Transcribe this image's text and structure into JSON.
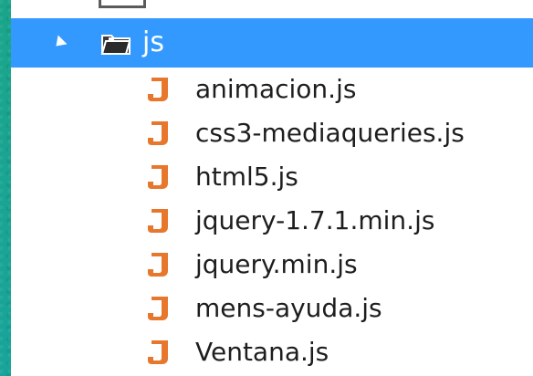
{
  "folder": {
    "label": "js",
    "expanded": true,
    "icon": "folder-icon",
    "highlight_color": "#3399ff"
  },
  "files": [
    {
      "label": "animacion.js",
      "icon": "js-file-icon"
    },
    {
      "label": "css3-mediaqueries.js",
      "icon": "js-file-icon"
    },
    {
      "label": "html5.js",
      "icon": "js-file-icon"
    },
    {
      "label": "jquery-1.7.1.min.js",
      "icon": "js-file-icon"
    },
    {
      "label": "jquery.min.js",
      "icon": "js-file-icon"
    },
    {
      "label": "mens-ayuda.js",
      "icon": "js-file-icon"
    },
    {
      "label": "Ventana.js",
      "icon": "js-file-icon"
    }
  ],
  "colors": {
    "file_icon": "#e8772e",
    "text": "#1e1e1e"
  }
}
